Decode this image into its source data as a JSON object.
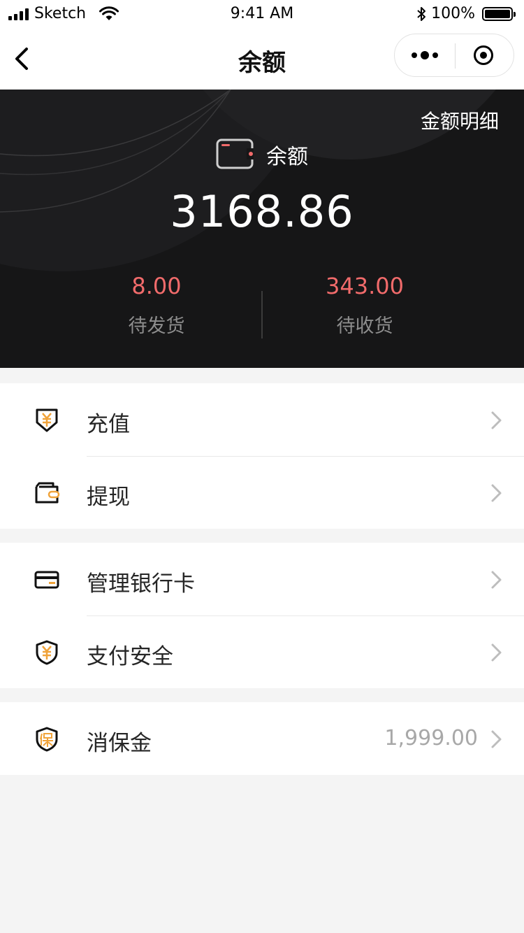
{
  "status_bar": {
    "carrier": "Sketch",
    "time": "9:41 AM",
    "battery": "100%",
    "battery_level": 1.0
  },
  "nav": {
    "title": "余额"
  },
  "hero": {
    "detail_link": "金额明细",
    "balance_label": "余额",
    "balance_value": "3168.86",
    "stats": [
      {
        "value": "8.00",
        "label": "待发货"
      },
      {
        "value": "343.00",
        "label": "待收货"
      }
    ]
  },
  "menu": [
    {
      "items": [
        {
          "label": "充值",
          "icon": "yuan-down-icon"
        },
        {
          "label": "提现",
          "icon": "wallet-icon"
        }
      ]
    },
    {
      "items": [
        {
          "label": "管理银行卡",
          "icon": "bank-card-icon"
        },
        {
          "label": "支付安全",
          "icon": "shield-yuan-icon"
        }
      ]
    },
    {
      "items": [
        {
          "label": "消保金",
          "icon": "shield-bao-icon",
          "value": "1,999.00"
        }
      ]
    }
  ],
  "colors": {
    "hero_bg": "#161617",
    "accent_red": "#f16b6b",
    "icon_accent": "#f0a33a",
    "page_bg": "#f4f4f4"
  }
}
